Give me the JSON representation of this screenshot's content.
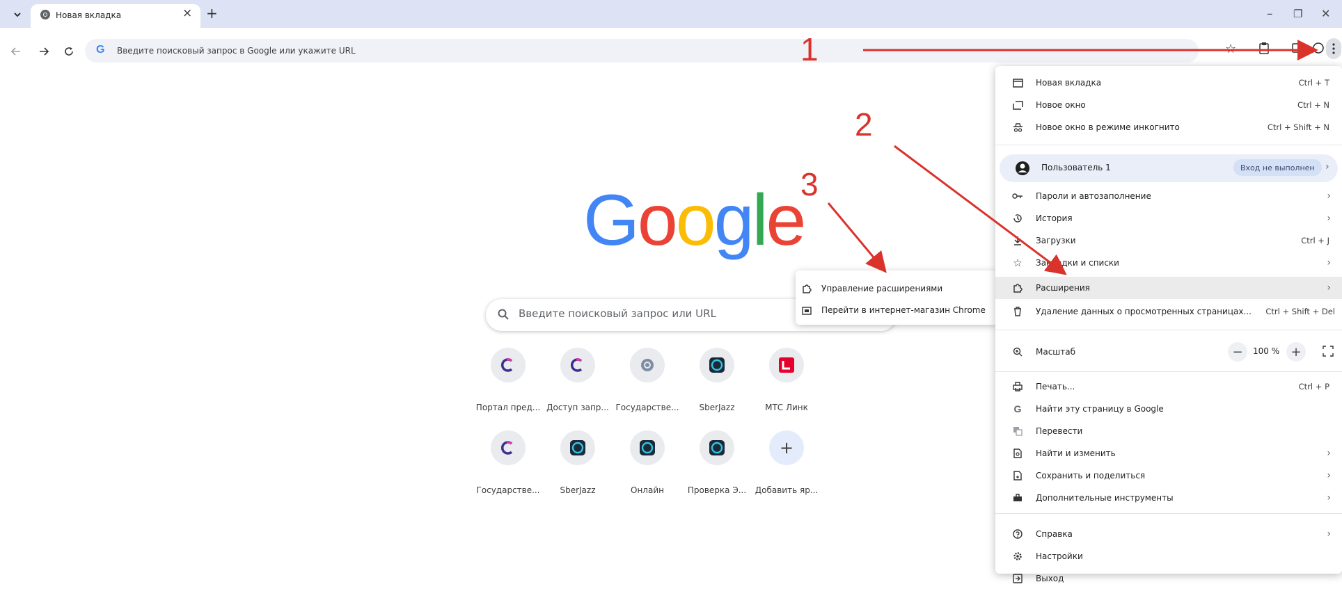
{
  "tab": {
    "title": "Новая вкладка",
    "close": "×",
    "new_tab": "+"
  },
  "window": {
    "minimize": "–",
    "restore": "❐",
    "close": "✕"
  },
  "omnibox": {
    "text": "Введите поисковый запрос в Google или укажите URL"
  },
  "ntp": {
    "logo_letters": [
      {
        "ch": "G",
        "color": "#4285f4"
      },
      {
        "ch": "o",
        "color": "#ea4335"
      },
      {
        "ch": "o",
        "color": "#fbbc05"
      },
      {
        "ch": "g",
        "color": "#4285f4"
      },
      {
        "ch": "l",
        "color": "#34a853"
      },
      {
        "ch": "e",
        "color": "#ea4335"
      }
    ],
    "search_placeholder": "Введите поисковый запрос или URL",
    "shortcuts_row1": [
      {
        "label": "Портал пред...",
        "icon": "c-logo-icon"
      },
      {
        "label": "Доступ запр...",
        "icon": "c-logo-icon"
      },
      {
        "label": "Государстве...",
        "icon": "emblem-icon"
      },
      {
        "label": "SberJazz",
        "icon": "sberjazz-icon"
      },
      {
        "label": "МТС Линк",
        "icon": "mts-link-icon"
      }
    ],
    "shortcuts_row2": [
      {
        "label": "Государстве...",
        "icon": "c-logo-icon"
      },
      {
        "label": "SberJazz",
        "icon": "sberjazz-icon"
      },
      {
        "label": "Онлайн",
        "icon": "sberjazz-icon"
      },
      {
        "label": "Проверка Э...",
        "icon": "sberjazz-icon"
      },
      {
        "label": "Добавить яр...",
        "icon": "plus-icon"
      }
    ]
  },
  "submenu": {
    "items": [
      {
        "label": "Управление расширениями",
        "icon": "puzzle-icon"
      },
      {
        "label": "Перейти в интернет-магазин Chrome",
        "icon": "store-icon"
      }
    ]
  },
  "menu": {
    "new_tab": {
      "label": "Новая вкладка",
      "shortcut": "Ctrl + T"
    },
    "new_window": {
      "label": "Новое окно",
      "shortcut": "Ctrl + N"
    },
    "incognito": {
      "label": "Новое окно в режиме инкогнито",
      "shortcut": "Ctrl + Shift + N"
    },
    "profile": {
      "label": "Пользователь 1",
      "badge": "Вход не выполнен"
    },
    "passwords": {
      "label": "Пароли и автозаполнение"
    },
    "history": {
      "label": "История"
    },
    "downloads": {
      "label": "Загрузки",
      "shortcut": "Ctrl + J"
    },
    "bookmarks": {
      "label": "Закладки и списки"
    },
    "extensions": {
      "label": "Расширения"
    },
    "clear_data": {
      "label": "Удаление данных о просмотренных страницах...",
      "shortcut": "Ctrl + Shift + Del"
    },
    "zoom": {
      "label": "Масштаб",
      "value": "100 %",
      "minus": "−",
      "plus": "+"
    },
    "print": {
      "label": "Печать...",
      "shortcut": "Ctrl + P"
    },
    "find_google": {
      "label": "Найти эту страницу в Google"
    },
    "translate": {
      "label": "Перевести"
    },
    "find_edit": {
      "label": "Найти и изменить"
    },
    "save_share": {
      "label": "Сохранить и поделиться"
    },
    "more_tools": {
      "label": "Дополнительные инструменты"
    },
    "help": {
      "label": "Справка"
    },
    "settings": {
      "label": "Настройки"
    },
    "exit": {
      "label": "Выход"
    },
    "arrow": "›"
  },
  "annotations": [
    "1",
    "2",
    "3"
  ],
  "colors": {
    "annotation": "#d9332c",
    "tabstrip": "#dde3f4",
    "highlight": "#ebebeb"
  }
}
